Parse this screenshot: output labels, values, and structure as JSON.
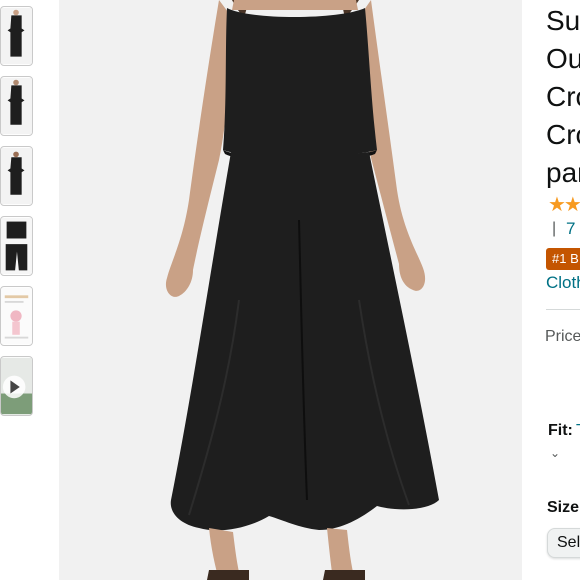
{
  "thumbnails": [
    {
      "name": "thumb-1"
    },
    {
      "name": "thumb-2"
    },
    {
      "name": "thumb-3"
    },
    {
      "name": "thumb-4"
    },
    {
      "name": "thumb-5"
    },
    {
      "name": "thumb-6-video"
    }
  ],
  "product": {
    "title_lines": [
      "Su",
      "Ou",
      "Cro",
      "Cro",
      "par"
    ],
    "stars_glyphs": "★★",
    "separator": "|",
    "rating_count": "7",
    "badge": "#1 B",
    "category": "Cloth",
    "price_label": "Price",
    "fit_label": "Fit:",
    "fit_value": "T",
    "fit_chevron": "⌄",
    "size_label": "Size",
    "size_select": "Sel"
  },
  "colors": {
    "accent_link": "#007185",
    "badge_bg": "#c45500",
    "star": "#f79a20",
    "garment": "#1e1e1e",
    "image_bg": "#f1f1f1"
  }
}
